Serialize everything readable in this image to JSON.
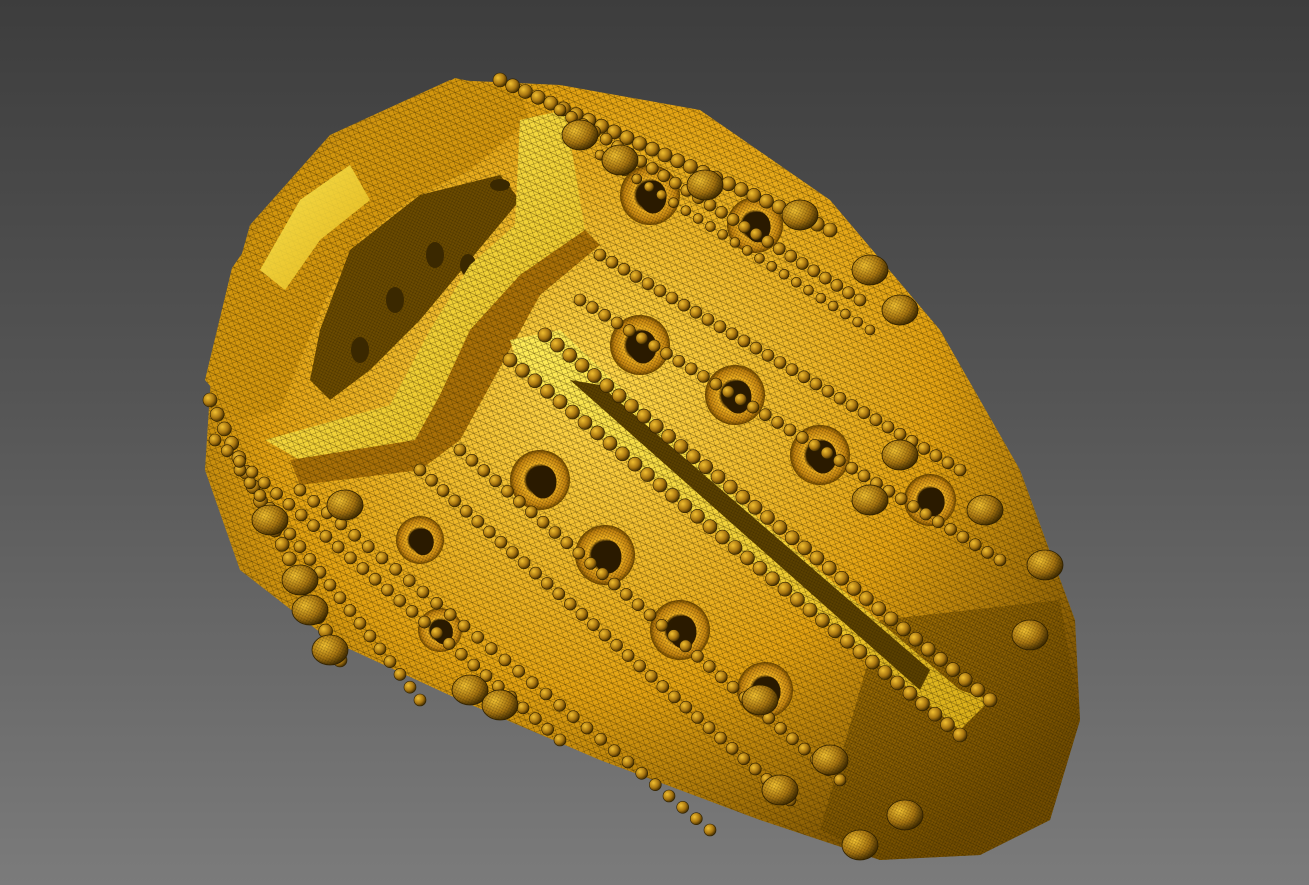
{
  "viewport": {
    "background_top": "#3d3d3d",
    "background_bottom": "#7b7b7b"
  },
  "model": {
    "display_mode": "shaded-with-wireframe",
    "surface_color": "#e0a010",
    "highlight_color": "#f6e23a",
    "wire_color": "#3a2800",
    "shadow_color": "#6a4600"
  }
}
